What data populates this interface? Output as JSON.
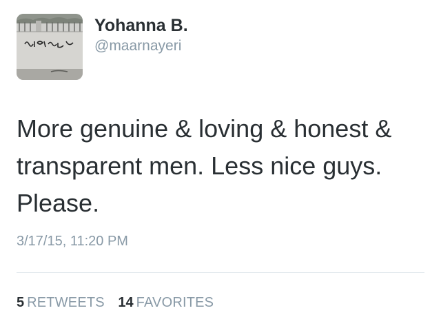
{
  "user": {
    "display_name": "Yohanna B.",
    "handle": "@maarnayeri",
    "avatar_icon": "profile-photo-graffiti-wall",
    "avatar_graffiti_text": "الموت للأسد الذليل"
  },
  "tweet": {
    "text": "More genuine & loving & honest & transparent men. Less nice guys. Please.",
    "timestamp": "3/17/15, 11:20 PM"
  },
  "stats": {
    "retweets_count": "5",
    "retweets_label": "RETWEETS",
    "favorites_count": "14",
    "favorites_label": "FAVORITES"
  },
  "colors": {
    "primary_text": "#292f33",
    "secondary_text": "#8899a6",
    "divider": "#e1e8ed"
  }
}
